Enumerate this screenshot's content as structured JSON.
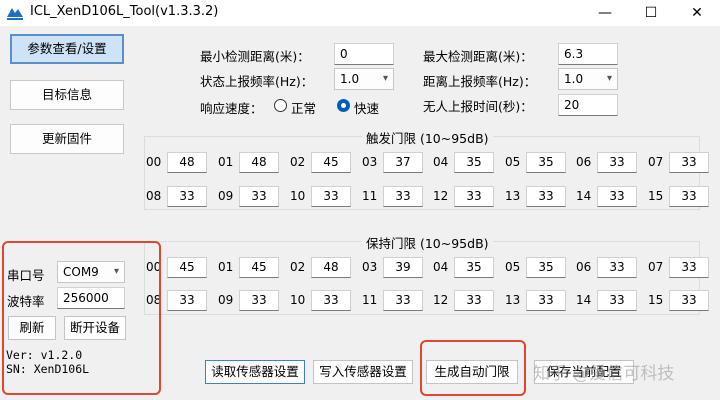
{
  "window": {
    "title": "ICL_XenD106L_Tool(v1.3.3.2)",
    "minimize": "—",
    "maximize": "☐",
    "close": "✕"
  },
  "left_buttons": [
    "参数查看/设置",
    "目标信息",
    "更新固件"
  ],
  "params": {
    "min_dist_label": "最小检测距离(米)：",
    "min_dist_value": "0",
    "max_dist_label": "最大检测距离(米)：",
    "max_dist_value": "6.3",
    "state_rate_label": "状态上报频率(Hz)：",
    "state_rate_value": "1.0",
    "dist_rate_label": "距离上报频率(Hz)：",
    "dist_rate_value": "1.0",
    "speed_label": "响应速度：",
    "speed_normal": "正常",
    "speed_fast": "快速",
    "speed_selected": "fast",
    "no_person_label": "无人上报时间(秒)：",
    "no_person_value": "20"
  },
  "trigger": {
    "title": "触发门限 (10~95dB)",
    "row1": [
      [
        "00",
        "48"
      ],
      [
        "01",
        "48"
      ],
      [
        "02",
        "45"
      ],
      [
        "03",
        "37"
      ],
      [
        "04",
        "35"
      ],
      [
        "05",
        "35"
      ],
      [
        "06",
        "33"
      ],
      [
        "07",
        "33"
      ]
    ],
    "row2": [
      [
        "08",
        "33"
      ],
      [
        "09",
        "33"
      ],
      [
        "10",
        "33"
      ],
      [
        "11",
        "33"
      ],
      [
        "12",
        "33"
      ],
      [
        "13",
        "33"
      ],
      [
        "14",
        "33"
      ],
      [
        "15",
        "33"
      ]
    ]
  },
  "hold": {
    "title": "保持门限 (10~95dB)",
    "row1": [
      [
        "00",
        "45"
      ],
      [
        "01",
        "45"
      ],
      [
        "02",
        "48"
      ],
      [
        "03",
        "39"
      ],
      [
        "04",
        "35"
      ],
      [
        "05",
        "35"
      ],
      [
        "06",
        "33"
      ],
      [
        "07",
        "33"
      ]
    ],
    "row2": [
      [
        "08",
        "33"
      ],
      [
        "09",
        "33"
      ],
      [
        "10",
        "33"
      ],
      [
        "11",
        "33"
      ],
      [
        "12",
        "33"
      ],
      [
        "13",
        "33"
      ],
      [
        "14",
        "33"
      ],
      [
        "15",
        "33"
      ]
    ]
  },
  "serial": {
    "port_label": "串口号",
    "port_value": "COM9",
    "baud_label": "波特率",
    "baud_value": "256000",
    "refresh": "刷新",
    "disconnect": "断开设备",
    "ver": "Ver: v1.2.0",
    "sn": "SN: XenD106L"
  },
  "bottom_buttons": [
    "读取传感器设置",
    "写入传感器设置",
    "生成自动门限",
    "保存当前配置"
  ],
  "watermark": "知乎 @爱信可科技",
  "colors": {
    "highlight": "#e0472f",
    "accent": "#005fb8",
    "active_button": "#cfe3f7"
  }
}
